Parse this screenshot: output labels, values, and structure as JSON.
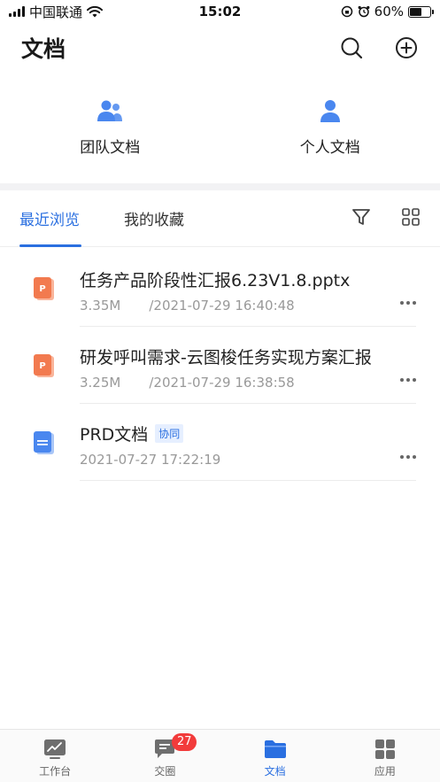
{
  "status_bar": {
    "carrier": "中国联通",
    "time": "15:02",
    "battery": "60%",
    "battery_level": 0.6
  },
  "header": {
    "title": "文档",
    "search_icon": "search-icon",
    "add_icon": "add-circle-icon"
  },
  "quick_entries": [
    {
      "label": "团队文档",
      "icon": "team-icon"
    },
    {
      "label": "个人文档",
      "icon": "person-icon"
    }
  ],
  "tabs": [
    {
      "label": "最近浏览",
      "active": true
    },
    {
      "label": "我的收藏",
      "active": false
    }
  ],
  "files": [
    {
      "name": "任务产品阶段性汇报6.23V1.8.pptx",
      "size": "3.35M",
      "time": "/2021-07-29 16:40:48",
      "type": "ppt",
      "badge": ""
    },
    {
      "name": "研发呼叫需求-云图梭任务实现方案汇报",
      "size": "3.25M",
      "time": "/2021-07-29 16:38:58",
      "type": "ppt",
      "badge": ""
    },
    {
      "name": "PRD文档",
      "size": "",
      "time": "2021-07-27 17:22:19",
      "type": "doc",
      "badge": "协同"
    }
  ],
  "bottom_nav": [
    {
      "label": "工作台",
      "icon": "workbench-icon",
      "active": false,
      "badge": ""
    },
    {
      "label": "交圈",
      "icon": "chat-icon",
      "active": false,
      "badge": "27"
    },
    {
      "label": "文档",
      "icon": "folder-icon",
      "active": true,
      "badge": ""
    },
    {
      "label": "应用",
      "icon": "apps-icon",
      "active": false,
      "badge": ""
    }
  ],
  "colors": {
    "accent": "#2a6fe0",
    "ppt": "#f27a4f",
    "doc": "#4a87ef",
    "badge_red": "#f23b3b"
  }
}
